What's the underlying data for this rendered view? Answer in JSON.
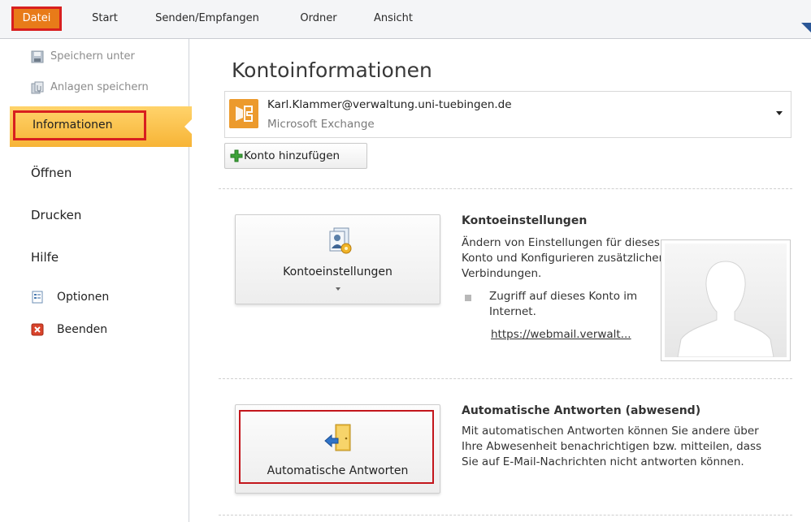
{
  "ribbon": {
    "tabs": [
      {
        "label": "Datei"
      },
      {
        "label": "Start"
      },
      {
        "label": "Senden/Empfangen"
      },
      {
        "label": "Ordner"
      },
      {
        "label": "Ansicht"
      }
    ],
    "accent_color": "#e87b19",
    "highlight_color": "#d81f1f"
  },
  "nav": {
    "save_as": "Speichern unter",
    "save_attachments": "Anlagen speichern",
    "info": "Informationen",
    "open": "Öffnen",
    "print": "Drucken",
    "help": "Hilfe",
    "options": "Optionen",
    "exit": "Beenden"
  },
  "main": {
    "title": "Kontoinformationen",
    "account": {
      "email": "Karl.Klammer@verwaltung.uni-tuebingen.de",
      "type": "Microsoft Exchange"
    },
    "add_account": "Konto hinzufügen",
    "account_settings": {
      "button_label": "Kontoeinstellungen",
      "title": "Kontoeinstellungen",
      "description": "Ändern von Einstellungen für dieses Konto und Konfigurieren zusätzlicher Verbindungen.",
      "bullet": "Zugriff auf dieses Konto im Internet.",
      "link": "https://webmail.verwalt..."
    },
    "auto_reply": {
      "button_label": "Automatische Antworten",
      "title": "Automatische Antworten (abwesend)",
      "description": "Mit automatischen Antworten können Sie andere über Ihre Abwesenheit benachrichtigen bzw. mitteilen, dass Sie auf E-Mail-Nachrichten nicht antworten können."
    }
  },
  "icons": {
    "save_as": "save-as-icon",
    "save_attachments": "save-attachments-icon",
    "options": "options-icon",
    "exit": "exit-icon",
    "exchange": "exchange-icon",
    "add": "plus-icon",
    "account_settings": "account-settings-icon",
    "auto_reply": "auto-reply-door-icon",
    "profile": "profile-silhouette-icon"
  }
}
